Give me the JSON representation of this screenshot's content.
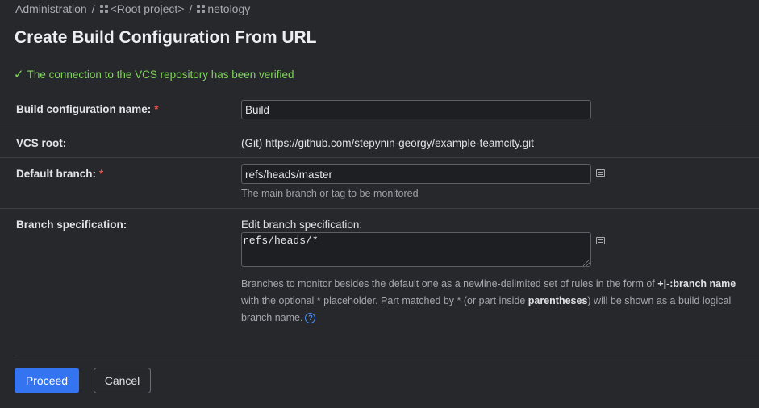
{
  "breadcrumb": {
    "items": [
      "Administration",
      "<Root project>",
      "netology"
    ],
    "separator": "/"
  },
  "page_title": "Create Build Configuration From URL",
  "status": {
    "icon": "check-icon",
    "message": "The connection to the VCS repository has been verified",
    "color": "#7fd65a"
  },
  "form": {
    "build_name": {
      "label": "Build configuration name:",
      "required_mark": "*",
      "value": "Build"
    },
    "vcs_root": {
      "label": "VCS root:",
      "value": "(Git) https://github.com/stepynin-georgy/example-teamcity.git"
    },
    "default_branch": {
      "label": "Default branch:",
      "required_mark": "*",
      "value": "refs/heads/master",
      "hint": "The main branch or tag to be monitored"
    },
    "branch_spec": {
      "label": "Branch specification:",
      "edit_label": "Edit branch specification:",
      "value": "refs/heads/*",
      "desc_part1": "Branches to monitor besides the default one as a newline-delimited set of rules in the form of ",
      "desc_bold1": "+|-:branch name",
      "desc_part2": " with the optional * placeholder. Part matched by * (or part inside ",
      "desc_bold2": "parentheses",
      "desc_part3": ") will be shown as a build logical branch name.",
      "help_icon": "?"
    }
  },
  "buttons": {
    "proceed": "Proceed",
    "cancel": "Cancel"
  },
  "colors": {
    "background": "#27282c",
    "accent": "#3574f0",
    "required": "#e5534b"
  }
}
